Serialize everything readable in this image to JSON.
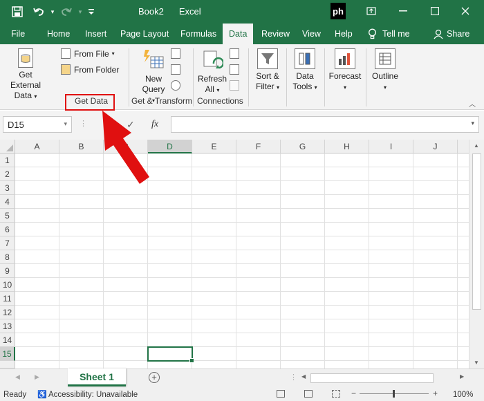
{
  "titlebar": {
    "title": "Book2",
    "app": "Excel",
    "watermark": "ph",
    "icons": [
      "save-icon",
      "undo-icon",
      "redo-icon",
      "customize-icon"
    ],
    "window_buttons": [
      "ribbon-display-icon",
      "minimize-icon",
      "maximize-icon",
      "close-icon"
    ]
  },
  "tabs": [
    {
      "label": "File"
    },
    {
      "label": "Home"
    },
    {
      "label": "Insert"
    },
    {
      "label": "Page Layout"
    },
    {
      "label": "Formulas"
    },
    {
      "label": "Data",
      "active": true
    },
    {
      "label": "Review"
    },
    {
      "label": "View"
    },
    {
      "label": "Help"
    },
    {
      "label": "Tell me"
    },
    {
      "label": "Share"
    }
  ],
  "ribbon": {
    "get_external_line1": "Get External",
    "get_external_line2": "Data",
    "from_file": "From File",
    "from_folder": "From Folder",
    "get_data_group": "Get Data",
    "new_query_line1": "New",
    "new_query_line2": "Query",
    "get_transform_group": "Get & Transform",
    "refresh_line1": "Refresh",
    "refresh_line2": "All",
    "connections_group": "Connections",
    "sort_line1": "Sort &",
    "sort_line2": "Filter",
    "data_tools_line1": "Data",
    "data_tools_line2": "Tools",
    "forecast": "Forecast",
    "outline": "Outline"
  },
  "formula_bar": {
    "name_box": "D15",
    "fx": "fx",
    "formula": ""
  },
  "grid": {
    "columns": [
      "A",
      "B",
      "C",
      "D",
      "E",
      "F",
      "G",
      "H",
      "I",
      "J"
    ],
    "rows": [
      "1",
      "2",
      "3",
      "4",
      "5",
      "6",
      "7",
      "8",
      "9",
      "10",
      "11",
      "12",
      "13",
      "14",
      "15"
    ],
    "selected_column": "D",
    "selected_row": "15",
    "active_cell": "D15"
  },
  "sheets": {
    "active": "Sheet 1"
  },
  "status": {
    "ready": "Ready",
    "accessibility": "Accessibility: Unavailable",
    "zoom": "100%"
  },
  "colors": {
    "accent": "#217346",
    "highlight": "#e01010"
  }
}
